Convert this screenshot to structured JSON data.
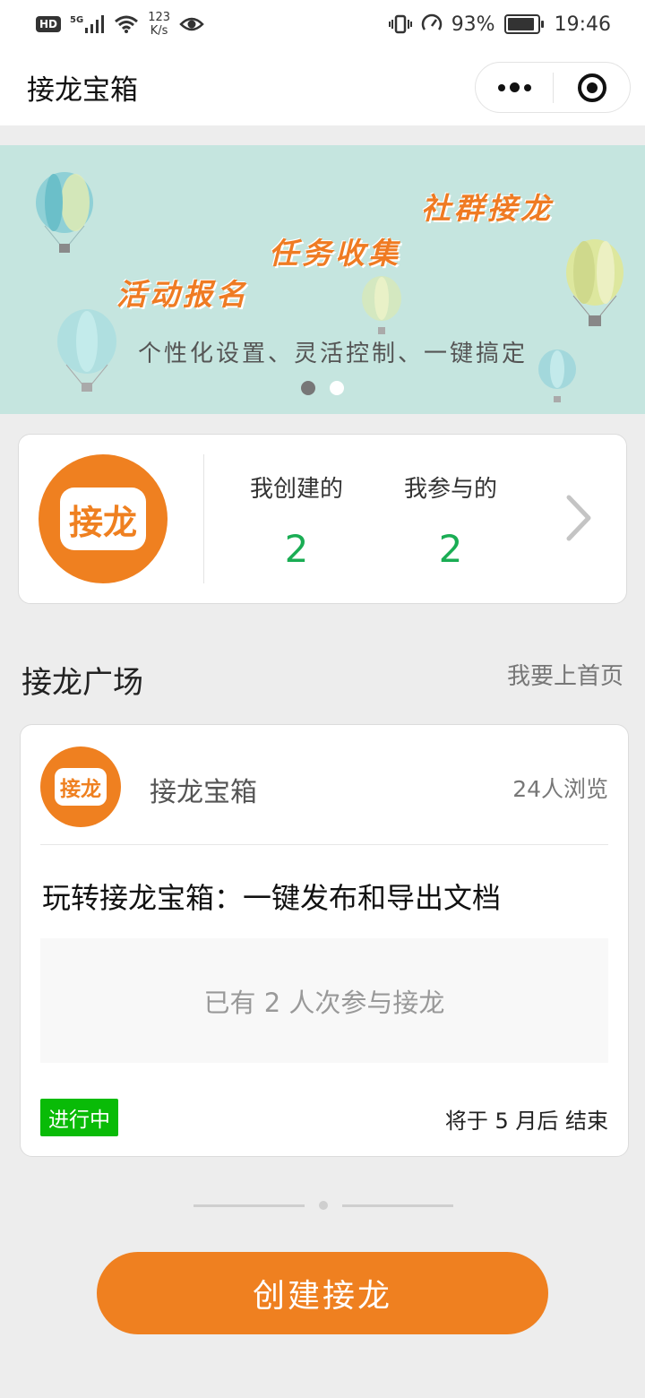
{
  "status_bar": {
    "network": "5G",
    "hd": "HD",
    "speed_value": "123",
    "speed_unit": "K/s",
    "battery_percent": "93%",
    "battery_level": 0.93,
    "time": "19:46"
  },
  "nav": {
    "title": "接龙宝箱"
  },
  "banner": {
    "headline_1": "社群接龙",
    "headline_2": "任务收集",
    "headline_3": "活动报名",
    "slogan": "个性化设置、灵活控制、一键搞定",
    "slide_count": 2,
    "active_slide": 1
  },
  "user_card": {
    "logo_text": "接龙",
    "created_label": "我创建的",
    "created_count": "2",
    "joined_label": "我参与的",
    "joined_count": "2"
  },
  "plaza": {
    "title": "接龙广场",
    "link": "我要上首页",
    "card": {
      "logo_text": "接龙",
      "author": "接龙宝箱",
      "views": "24人浏览",
      "title": "玩转接龙宝箱：一键发布和导出文档",
      "participation": "已有 2 人次参与接龙",
      "status": "进行中",
      "end_info": "将于 5 月后 结束"
    }
  },
  "actions": {
    "create_label": "创建接龙"
  },
  "colors": {
    "brand_orange": "#ef8020",
    "count_green": "#1aad54",
    "status_green": "#09bb07",
    "banner_bg": "#c5e5df"
  }
}
